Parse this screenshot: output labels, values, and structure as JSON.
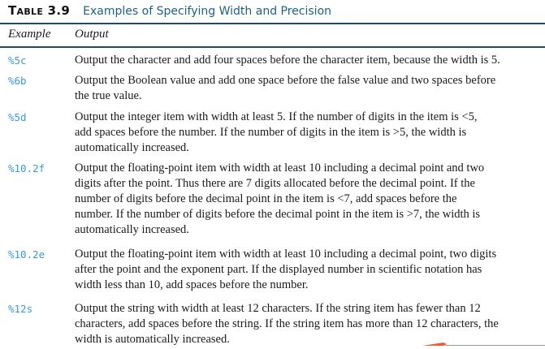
{
  "table": {
    "label": "Table 3.9",
    "title": "Examples of Specifying Width and Precision",
    "headers": {
      "example": "Example",
      "output": "Output"
    },
    "rows": [
      {
        "code": "%5c",
        "lines": [
          "Output the character and add four spaces before the character item, because the width is 5."
        ]
      },
      {
        "code": "%6b",
        "lines": [
          "Output the Boolean value and add one space before the false value and two spaces before",
          "the true value."
        ]
      },
      {
        "code": "%5d",
        "lines": [
          "Output the integer item with width at least 5. If the number of digits in the item is <5,",
          "add spaces before the number. If the number of digits in the item is >5, the width is",
          "automatically increased."
        ]
      },
      {
        "code": "%10.2f",
        "lines": [
          "Output the floating-point item with width at least 10 including a decimal point and two",
          "digits after the point. Thus there are 7 digits allocated before the decimal point. If the",
          "number of digits before the decimal point in the item is <7, add spaces before the",
          "number. If the number of digits before the decimal point in the item is >7, the width is",
          "automatically increased."
        ]
      },
      {
        "code": "%10.2e",
        "lines": [
          "Output the floating-point item with width at least 10 including a decimal point, two digits",
          "after the point and the exponent part. If the displayed number in scientific notation has",
          "width less than 10, add spaces before the number."
        ]
      },
      {
        "code": "%12s",
        "lines": [
          "Output the string with width at least 12 characters. If the string item has fewer than 12",
          "characters, add spaces before the string. If the string item has more than 12 characters, the",
          "width is automatically increased."
        ]
      }
    ]
  },
  "colors": {
    "title": "#1f5f7f",
    "code": "#3a9ad9",
    "rule": "#1c4d66",
    "arrow": "#e8603a"
  }
}
